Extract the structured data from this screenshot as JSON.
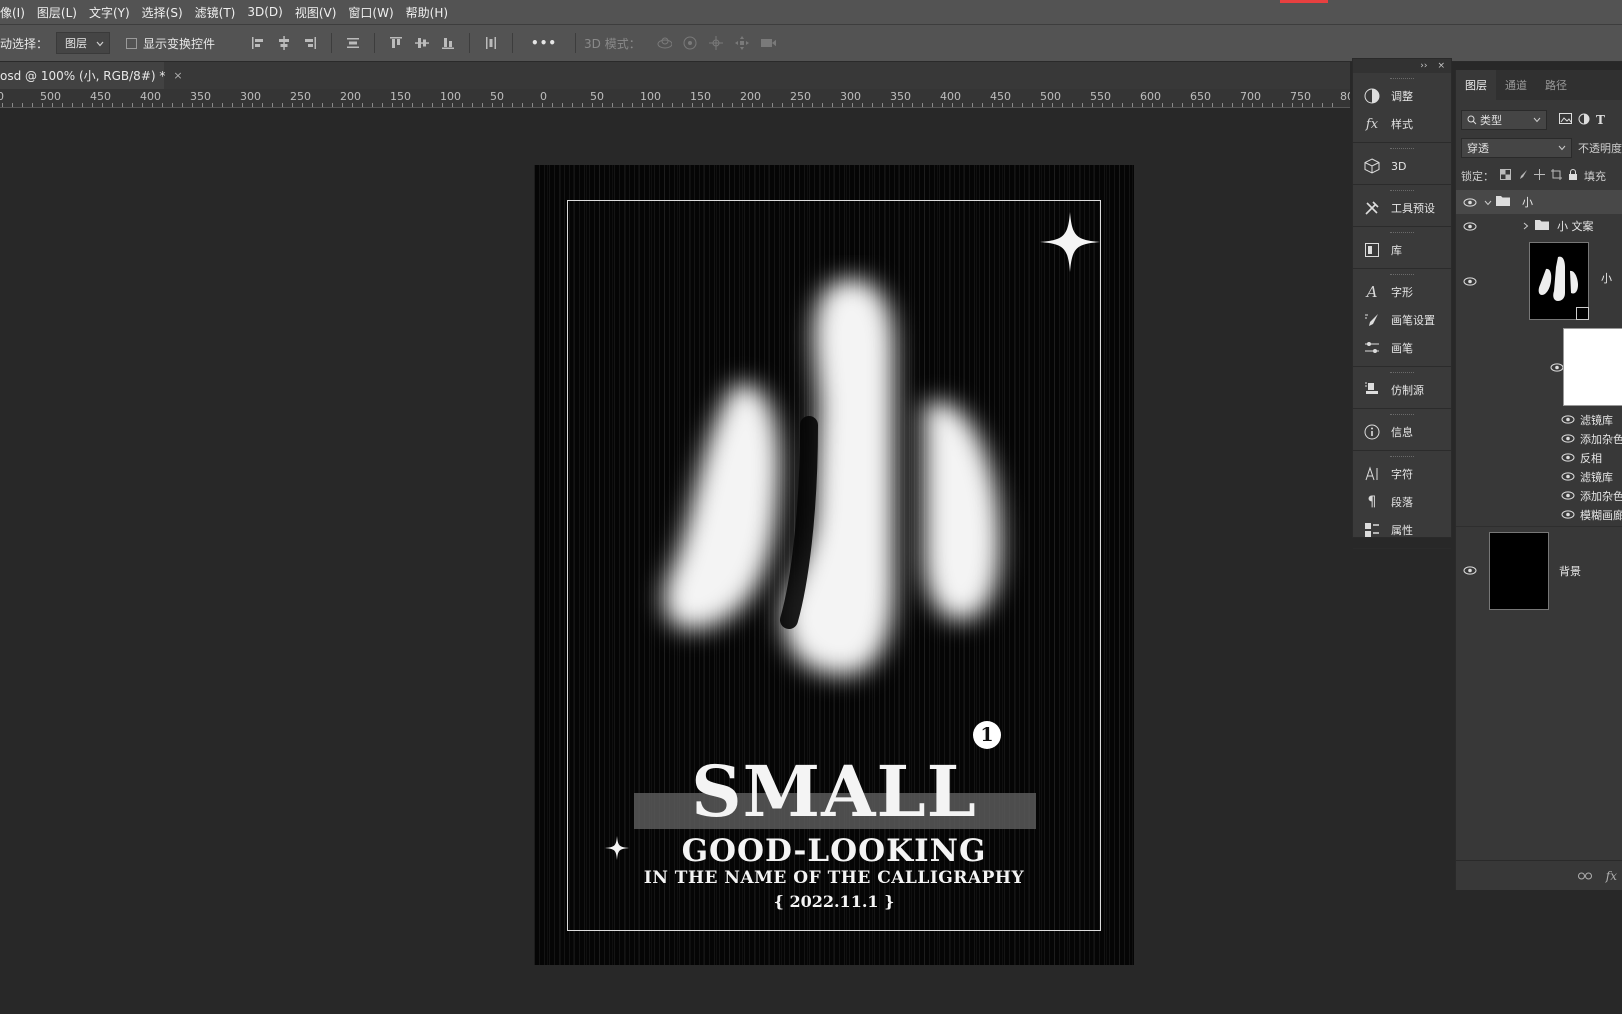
{
  "menu": {
    "items": [
      "像(I)",
      "图层(L)",
      "文字(Y)",
      "选择(S)",
      "滤镜(T)",
      "3D(D)",
      "视图(V)",
      "窗口(W)",
      "帮助(H)"
    ]
  },
  "options": {
    "auto_select_label": "动选择：",
    "auto_select_value": "图层",
    "show_transform_label": "显示变换控件",
    "more_label": "•••",
    "mode_3d_label": "3D 模式："
  },
  "doc_tab": {
    "title": "osd @ 100% (小, RGB/8#) *",
    "close": "×"
  },
  "ruler": {
    "labels": [
      "00",
      "500",
      "450",
      "400",
      "350",
      "300",
      "250",
      "200",
      "150",
      "100",
      "50",
      "0",
      "50",
      "100",
      "150",
      "200",
      "250",
      "300",
      "350",
      "400",
      "450",
      "500",
      "550",
      "600",
      "650",
      "700",
      "750",
      "80"
    ]
  },
  "canvas": {
    "title": "SMALL",
    "subtitle": "GOOD-LOOKING",
    "tagline": "IN THE NAME OF THE CALLIGRAPHY",
    "date": "{  2022.11.1  }",
    "marker": "1"
  },
  "dock": {
    "header_collapse": "››",
    "header_close": "×",
    "groups": [
      [
        {
          "label": "调整",
          "icon": "adjustments-icon"
        },
        {
          "label": "样式",
          "icon": "styles-fx-icon"
        }
      ],
      [
        {
          "label": "3D",
          "icon": "cube-3d-icon"
        }
      ],
      [
        {
          "label": "工具预设",
          "icon": "tool-presets-icon"
        }
      ],
      [
        {
          "label": "库",
          "icon": "libraries-icon"
        }
      ],
      [
        {
          "label": "字形",
          "icon": "glyphs-icon"
        },
        {
          "label": "画笔设置",
          "icon": "brush-settings-icon"
        },
        {
          "label": "画笔",
          "icon": "brushes-icon"
        }
      ],
      [
        {
          "label": "仿制源",
          "icon": "clone-source-icon"
        }
      ],
      [
        {
          "label": "信息",
          "icon": "info-icon"
        }
      ],
      [
        {
          "label": "字符",
          "icon": "character-icon"
        },
        {
          "label": "段落",
          "icon": "paragraph-icon"
        },
        {
          "label": "属性",
          "icon": "properties-icon"
        }
      ]
    ]
  },
  "layers_panel": {
    "tabs": [
      "图层",
      "通道",
      "路径"
    ],
    "filter_kind": "类型",
    "blend_mode": "穿透",
    "opacity_label": "不透明度",
    "lock_label": "锁定：",
    "fill_label": "填充",
    "layers": {
      "group_name": "小",
      "subgroup_name": "小 文案",
      "smart_layer_name": "小",
      "background_name": "背景"
    },
    "effects": [
      "滤镜库",
      "添加杂色",
      "反相",
      "滤镜库",
      "添加杂色",
      "模糊画廊"
    ]
  },
  "colors": {
    "accent_red": "#e84040",
    "panel_bg": "#383838",
    "menu_bg": "#535353",
    "workspace_bg": "#282828"
  }
}
